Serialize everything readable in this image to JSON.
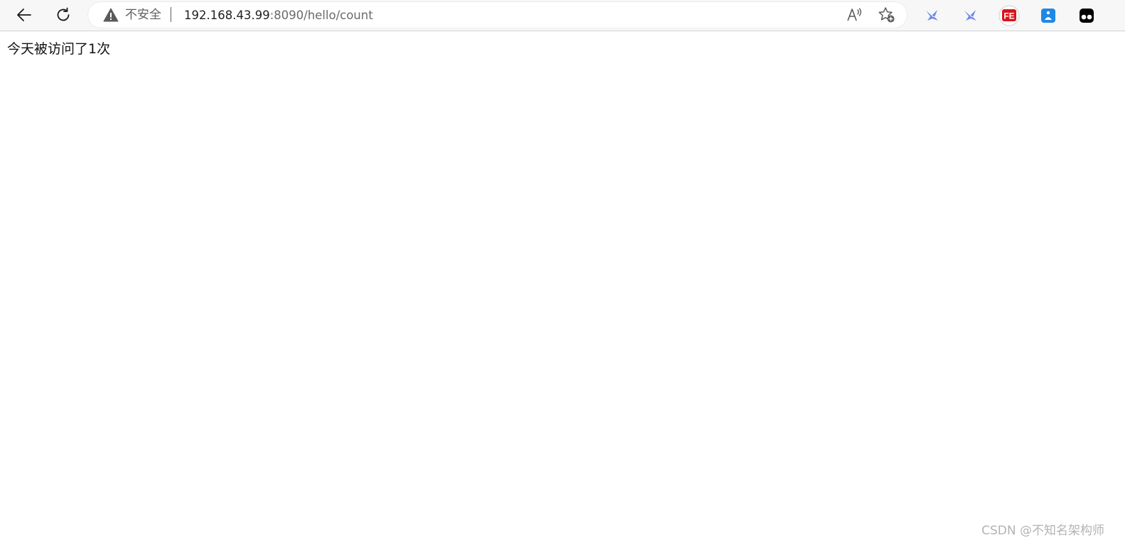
{
  "browser": {
    "security_label": "不安全",
    "url_host": "192.168.43.99",
    "url_rest": ":8090/hello/count",
    "back_icon": "back-arrow-icon",
    "reload_icon": "reload-icon",
    "read_aloud_icon": "read-aloud-icon",
    "favorite_icon": "add-favorite-icon",
    "extensions": [
      {
        "name": "bird-extension-icon",
        "color": "#6f86f0"
      },
      {
        "name": "bird-extension-icon",
        "color": "#6f86f0"
      },
      {
        "name": "fe-extension-icon",
        "label": "FE",
        "color": "#d9131a"
      },
      {
        "name": "blue-extension-icon",
        "color": "#1e88e5"
      },
      {
        "name": "tampermonkey-extension-icon",
        "color": "#000000"
      }
    ]
  },
  "page": {
    "text": "今天被访问了1次"
  },
  "watermark": {
    "text": "CSDN @不知名架构师"
  }
}
